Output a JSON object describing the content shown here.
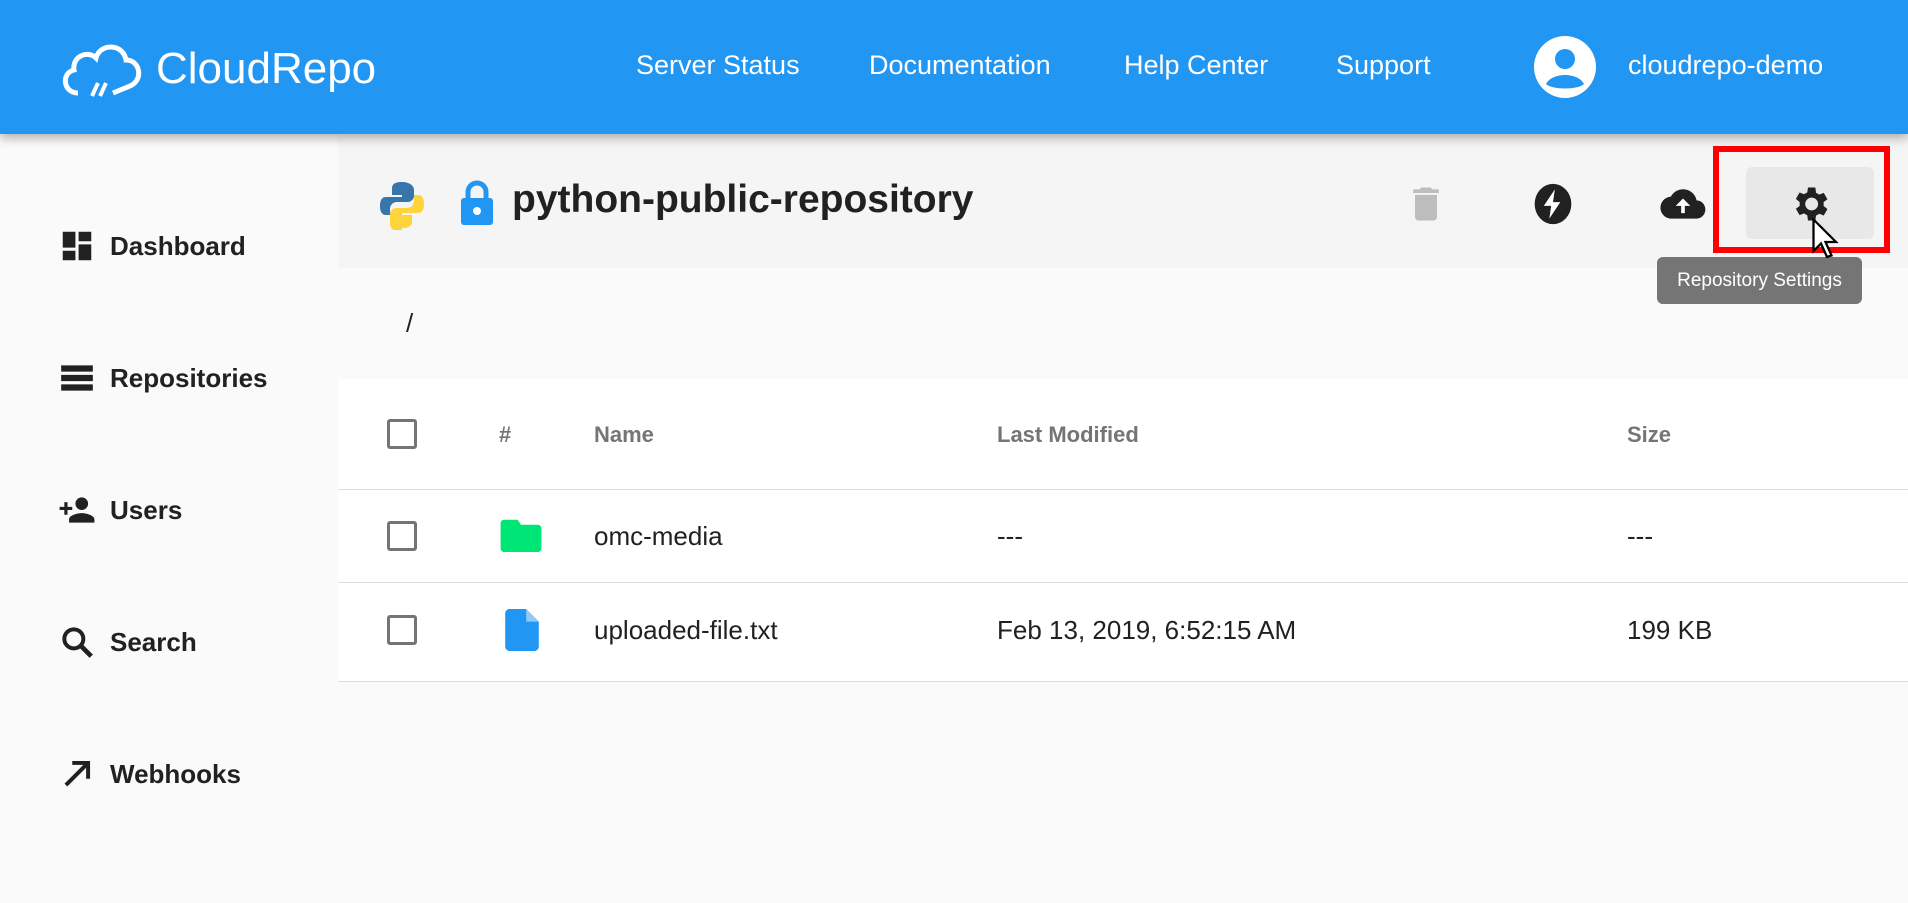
{
  "brand": {
    "name": "CloudRepo",
    "color": "#2196f3"
  },
  "nav": {
    "items": [
      "Server Status",
      "Documentation",
      "Help Center",
      "Support"
    ],
    "username": "cloudrepo-demo"
  },
  "sidebar": {
    "items": [
      {
        "label": "Dashboard",
        "icon": "dashboard-icon"
      },
      {
        "label": "Repositories",
        "icon": "list-icon"
      },
      {
        "label": "Users",
        "icon": "add-user-icon"
      },
      {
        "label": "Search",
        "icon": "search-icon"
      },
      {
        "label": "Webhooks",
        "icon": "arrow-up-right-icon"
      }
    ]
  },
  "repo": {
    "title": "python-public-repository",
    "toolbar": [
      "trash-icon",
      "bolt-icon",
      "cloud-upload-icon",
      "gear-icon"
    ],
    "tooltip": "Repository Settings",
    "breadcrumb": "/"
  },
  "table": {
    "headers": {
      "number": "#",
      "name": "Name",
      "modified": "Last Modified",
      "size": "Size"
    },
    "rows": [
      {
        "name": "omc-media",
        "type": "folder",
        "modified": "---",
        "size": "---"
      },
      {
        "name": "uploaded-file.txt",
        "type": "file",
        "modified": "Feb 13, 2019, 6:52:15 AM",
        "size": "199 KB"
      }
    ]
  }
}
